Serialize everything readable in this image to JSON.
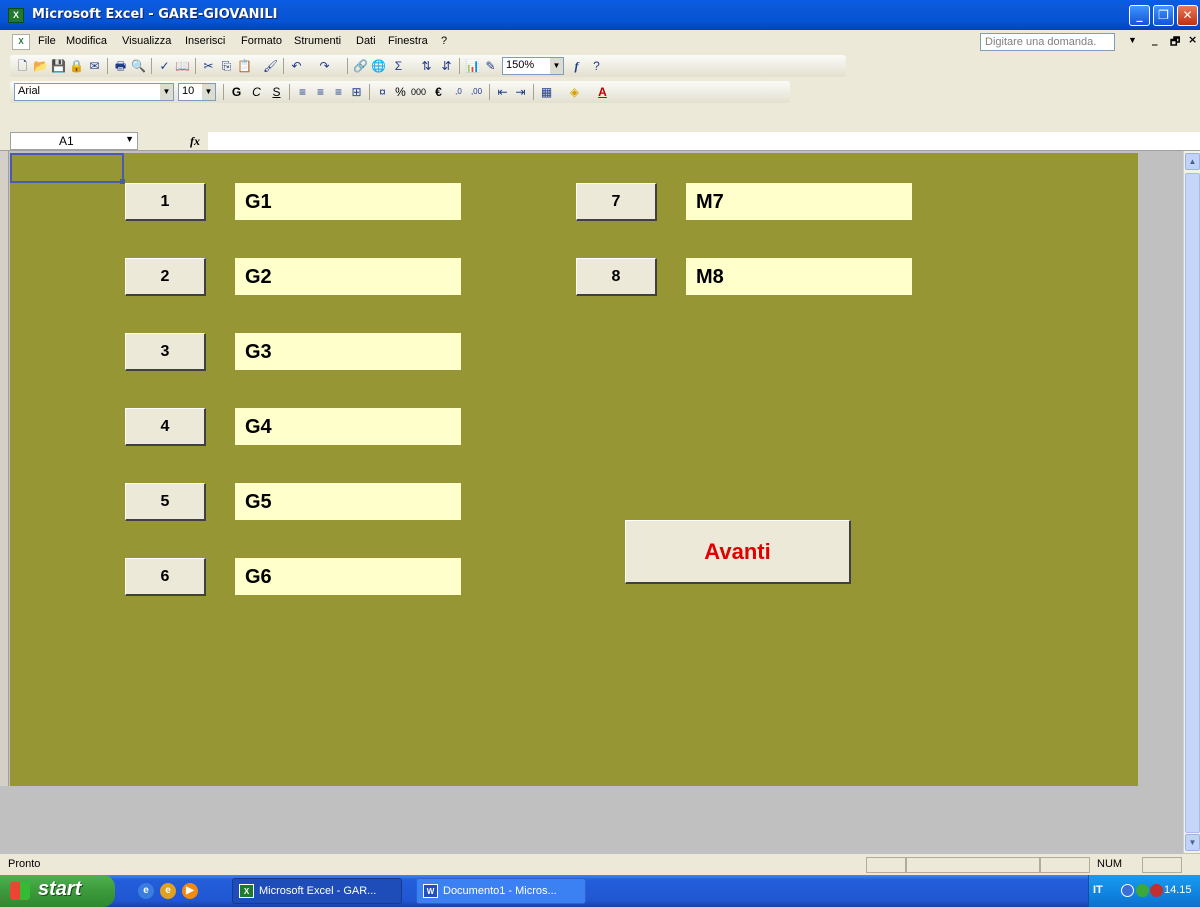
{
  "window": {
    "title": "Microsoft Excel - GARE-GIOVANILI"
  },
  "menu": {
    "items": [
      "File",
      "Modifica",
      "Visualizza",
      "Inserisci",
      "Formato",
      "Strumenti",
      "Dati",
      "Finestra",
      "?"
    ],
    "ask_placeholder": "Digitare una domanda."
  },
  "standard_toolbar": {
    "zoom": "150%"
  },
  "format_toolbar": {
    "font": "Arial",
    "font_size": "10",
    "bold": "G",
    "italic": "C",
    "underline": "S"
  },
  "formula_bar": {
    "name_box": "A1",
    "fx": "fx",
    "content": ""
  },
  "sheet": {
    "left_buttons": [
      {
        "number": "1",
        "label": "G1"
      },
      {
        "number": "2",
        "label": "G2"
      },
      {
        "number": "3",
        "label": "G3"
      },
      {
        "number": "4",
        "label": "G4"
      },
      {
        "number": "5",
        "label": "G5"
      },
      {
        "number": "6",
        "label": "G6"
      }
    ],
    "right_buttons": [
      {
        "number": "7",
        "label": "M7"
      },
      {
        "number": "8",
        "label": "M8"
      }
    ],
    "next_button": "Avanti",
    "background_color": "#979634",
    "label_color": "#ffffcc",
    "next_text_color": "#e00000"
  },
  "status": {
    "text": "Pronto",
    "num": "NUM"
  },
  "taskbar": {
    "start": "start",
    "tasks": [
      "Microsoft Excel - GAR...",
      "Documento1 - Micros..."
    ],
    "lang": "IT",
    "clock": "14.15"
  }
}
